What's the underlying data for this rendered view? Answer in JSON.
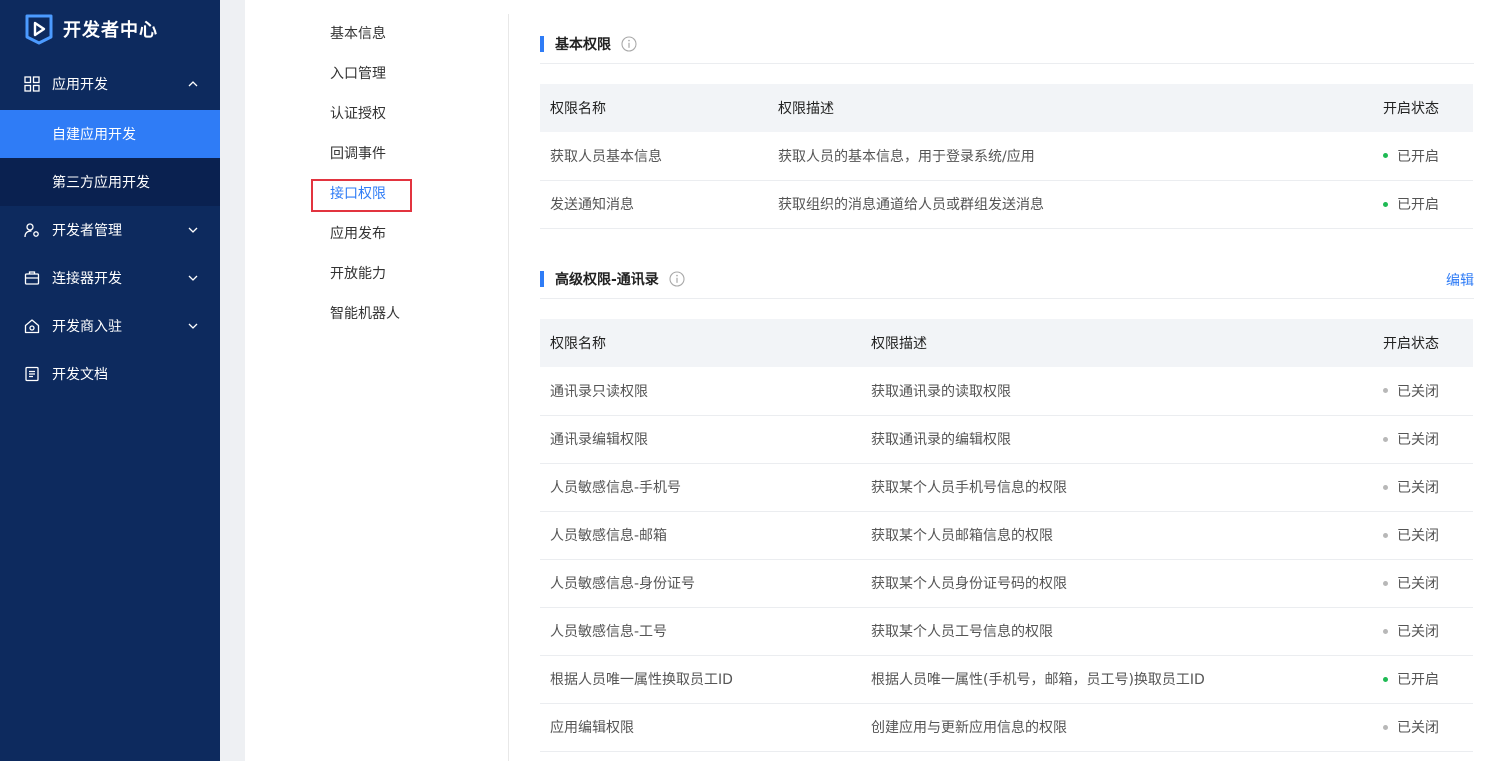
{
  "colors": {
    "sidebar_bg": "#0d2a5e",
    "active_blue": "#2f7cf6",
    "enabled_green": "#1fba54",
    "disabled_gray": "#b8b8b8",
    "highlight_red": "#e2343f"
  },
  "sidebar": {
    "title": "开发者中心",
    "groups": [
      {
        "label": "应用开发",
        "icon": "grid-icon",
        "expanded": true,
        "items": [
          {
            "label": "自建应用开发",
            "active": true
          },
          {
            "label": "第三方应用开发",
            "active": false
          }
        ]
      },
      {
        "label": "开发者管理",
        "icon": "user-gear-icon",
        "expanded": false
      },
      {
        "label": "连接器开发",
        "icon": "briefcase-icon",
        "expanded": false
      },
      {
        "label": "开发商入驻",
        "icon": "home-gear-icon",
        "expanded": false
      },
      {
        "label": "开发文档",
        "icon": "document-icon"
      }
    ]
  },
  "second_nav": {
    "items": [
      "基本信息",
      "入口管理",
      "认证授权",
      "回调事件",
      "接口权限",
      "应用发布",
      "开放能力",
      "智能机器人"
    ],
    "active_index": 4
  },
  "basic_section": {
    "title": "基本权限",
    "columns": [
      "权限名称",
      "权限描述",
      "开启状态"
    ],
    "rows": [
      {
        "name": "获取人员基本信息",
        "desc": "获取人员的基本信息，用于登录系统/应用",
        "status": "已开启",
        "on": true
      },
      {
        "name": "发送通知消息",
        "desc": "获取组织的消息通道给人员或群组发送消息",
        "status": "已开启",
        "on": true
      }
    ]
  },
  "advanced_section": {
    "title": "高级权限-通讯录",
    "edit_label": "编辑",
    "columns": [
      "权限名称",
      "权限描述",
      "开启状态"
    ],
    "rows": [
      {
        "name": "通讯录只读权限",
        "desc": "获取通讯录的读取权限",
        "status": "已关闭",
        "on": false
      },
      {
        "name": "通讯录编辑权限",
        "desc": "获取通讯录的编辑权限",
        "status": "已关闭",
        "on": false
      },
      {
        "name": "人员敏感信息-手机号",
        "desc": "获取某个人员手机号信息的权限",
        "status": "已关闭",
        "on": false
      },
      {
        "name": "人员敏感信息-邮箱",
        "desc": "获取某个人员邮箱信息的权限",
        "status": "已关闭",
        "on": false
      },
      {
        "name": "人员敏感信息-身份证号",
        "desc": "获取某个人员身份证号码的权限",
        "status": "已关闭",
        "on": false
      },
      {
        "name": "人员敏感信息-工号",
        "desc": "获取某个人员工号信息的权限",
        "status": "已关闭",
        "on": false
      },
      {
        "name": "根据人员唯一属性换取员工ID",
        "desc": "根据人员唯一属性(手机号，邮箱，员工号)换取员工ID",
        "status": "已开启",
        "on": true
      },
      {
        "name": "应用编辑权限",
        "desc": "创建应用与更新应用信息的权限",
        "status": "已关闭",
        "on": false
      }
    ]
  }
}
